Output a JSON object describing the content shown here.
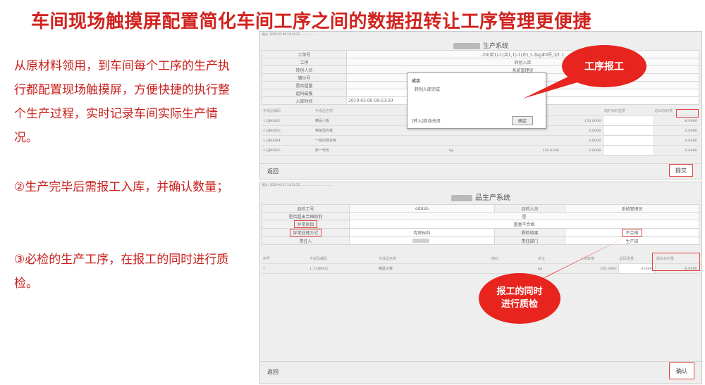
{
  "slide": {
    "title": "车间现场触摸屏配置简化车间工序之间的数据扭转让工序管理更便捷",
    "para1": "从原材料领用，到车间每个工序的生产执行都配置现场触摸屏，方便快捷的执行整个生产过程，实时记录车间实际生产情况。",
    "para2": "②生产完毕后需报工入库，并确认数量；",
    "para3": "③必检的生产工序，在报工的同时进行质检。",
    "colors": {
      "title": "#d1231f",
      "text": "#c8201c",
      "bubble": "#e8241e",
      "highlight": "#e0453e"
    }
  },
  "screen1": {
    "url": "报文: 2019-03-08 14:21:22 ...... ...... ...",
    "system_title": "生产系统",
    "form": [
      {
        "label": "工单号",
        "value": "-20(单1)-1(共1,1)-1(正),1.2kg#0号,3/1.1"
      },
      {
        "label": "工序",
        "value": "转创入库"
      },
      {
        "label": "转创人员",
        "value": "系统管理员"
      },
      {
        "label": "辅沙号",
        "value": "1#班"
      },
      {
        "label": "是否超量",
        "value": "是"
      },
      {
        "label": "起码最报",
        "value": ""
      },
      {
        "label": "入库时间",
        "value": "2019-03-08 09:53:29"
      }
    ],
    "dialog": {
      "title": "成功",
      "message": "转创入库完成",
      "hint": "[转入]自动关闭",
      "ok_label": "确定"
    },
    "grid_headers": [
      "半成品编码",
      "半成品名称",
      "",
      "",
      "",
      "",
      "临时标料重量",
      "超出标料量"
    ],
    "grid_rows": [
      [
        "11JB0002",
        "精品小板",
        "",
        "",
        "",
        "150.0000",
        "",
        "-6.0000"
      ],
      [
        "11JB0003",
        "特级混合板",
        "",
        "",
        "",
        "0.0000",
        "",
        "0.0000"
      ],
      [
        "11JB0004",
        "一级向混合板",
        "",
        "",
        "",
        "0.0000",
        "",
        "0.0000"
      ],
      [
        "11JB0005",
        "新一代专",
        "",
        "kg",
        "150.0000",
        "0.0000",
        "",
        "0.0000"
      ]
    ],
    "back_label": "返回",
    "submit_label": "提交",
    "callout": "工序报工"
  },
  "screen2": {
    "url": "报文: 2019-03-11 14:21:22 ...... ...... ... ...... ...... ...",
    "system_title": "品生产系统",
    "form_rows": [
      [
        "品检工号",
        "admin",
        "品检人员",
        "系统管理员"
      ],
      [
        "是否超出合格权利",
        "是",
        "",
        ""
      ],
      [
        "异常原因",
        "重量不合格",
        "",
        ""
      ],
      [
        "异常处理方式",
        "库房标料",
        "质检结果",
        "不合格"
      ],
      [
        "责任人",
        "",
        "责任部门",
        "生产部"
      ]
    ],
    "grid_headers": [
      "序号",
      "半成品编码",
      "半成品名称",
      "物料",
      "单位",
      "入库数量",
      "起码重量",
      "超出标料量"
    ],
    "grid_row": [
      "1",
      "1.11JB002",
      "精品小板",
      "",
      "kg",
      "150.0000",
      "0.0000",
      "-6.0000"
    ],
    "back_label": "返回",
    "confirm_label": "确认",
    "callout_line1": "报工的同时",
    "callout_line2": "进行质检"
  }
}
